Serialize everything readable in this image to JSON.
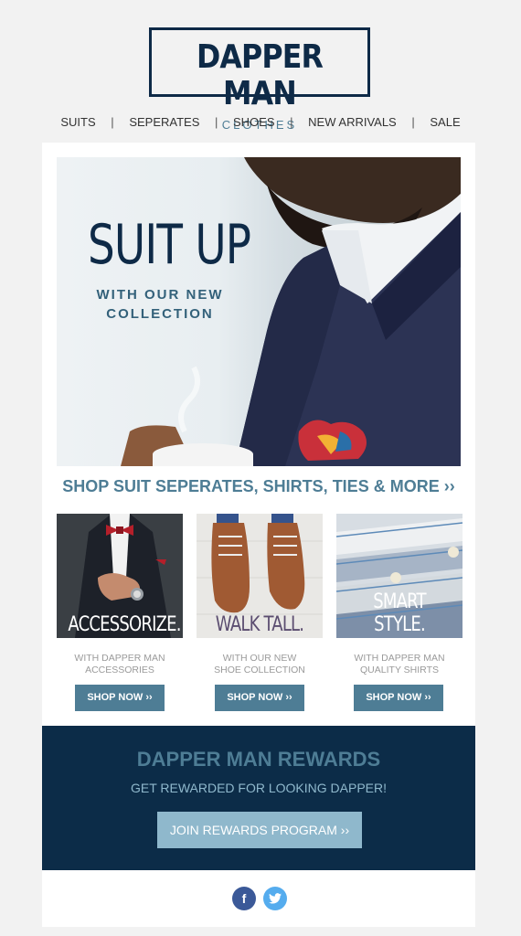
{
  "header": {
    "brand_name": "DAPPER MAN",
    "brand_sub": "CLOTHES",
    "nav": [
      "SUITS",
      "SEPERATES",
      "SHOES",
      "NEW ARRIVALS",
      "SALE"
    ],
    "nav_separator": "|"
  },
  "hero": {
    "title": "SUIT UP",
    "subtitle_line1": "WITH OUR NEW",
    "subtitle_line2": "COLLECTION"
  },
  "shop_line": "SHOP SUIT SEPERATES, SHIRTS, TIES & MORE ››",
  "products": [
    {
      "label": "ACCESSORIZE.",
      "caption_line1": "WITH DAPPER MAN",
      "caption_line2": "ACCESSORIES",
      "button": "SHOP NOW ››"
    },
    {
      "label": "WALK TALL.",
      "caption_line1": "WITH OUR NEW",
      "caption_line2": "SHOE COLLECTION",
      "button": "SHOP NOW ››"
    },
    {
      "label": "SMART STYLE.",
      "caption_line1": "WITH DAPPER MAN",
      "caption_line2": "QUALITY SHIRTS",
      "button": "SHOP NOW ››"
    }
  ],
  "rewards": {
    "title": "DAPPER MAN REWARDS",
    "subtitle": "GET REWARDED FOR LOOKING DAPPER!",
    "button": "JOIN REWARDS PROGRAM ››"
  },
  "social": {
    "facebook": "f",
    "twitter": "t"
  },
  "colors": {
    "navy": "#0e2a47",
    "accent_blue": "#4e7d95",
    "light_blue": "#8fb8cc",
    "rewards_bg": "#0c2c48",
    "facebook": "#3b5998",
    "twitter": "#55acee"
  }
}
